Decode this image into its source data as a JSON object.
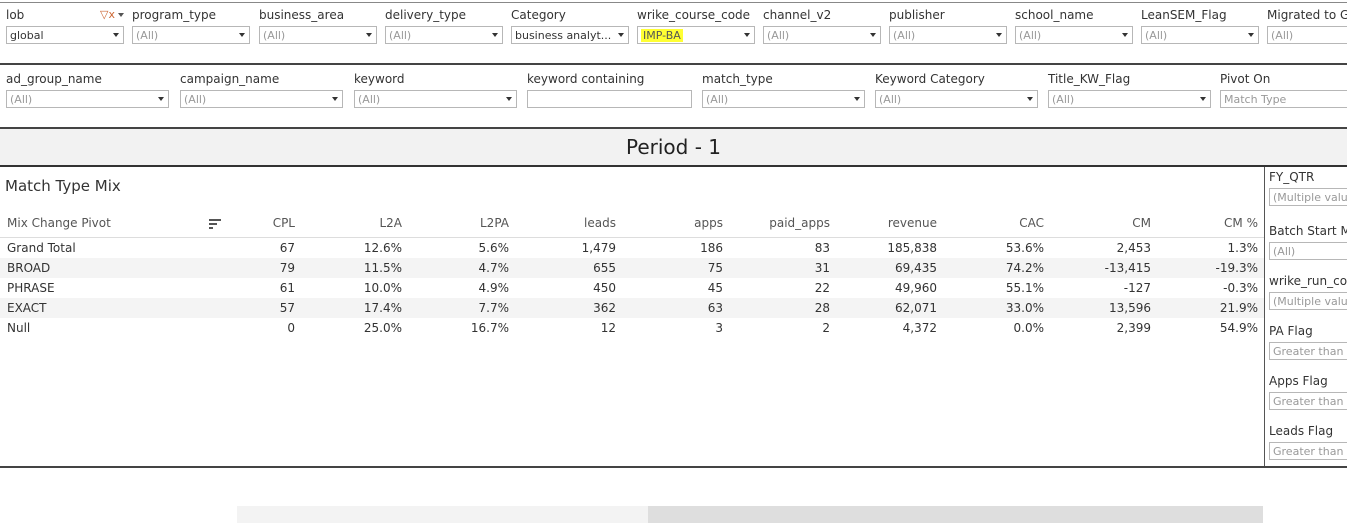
{
  "filters_row1": [
    {
      "label": "lob",
      "value": "global",
      "selected": true,
      "has_filter_icon": true
    },
    {
      "label": "program_type",
      "value": "(All)"
    },
    {
      "label": "business_area",
      "value": "(All)"
    },
    {
      "label": "delivery_type",
      "value": "(All)"
    },
    {
      "label": "Category",
      "value": "business analyt...",
      "selected": true
    },
    {
      "label": "wrike_course_code",
      "value": "IMP-BA",
      "highlighted": true
    },
    {
      "label": "channel_v2",
      "value": "(All)"
    },
    {
      "label": "publisher",
      "value": "(All)"
    },
    {
      "label": "school_name",
      "value": "(All)"
    },
    {
      "label": "LeanSEM_Flag",
      "value": "(All)"
    },
    {
      "label": "Migrated to G",
      "value": "(All)"
    }
  ],
  "filters_row2": [
    {
      "label": "ad_group_name",
      "value": "(All)"
    },
    {
      "label": "campaign_name",
      "value": "(All)"
    },
    {
      "label": "keyword",
      "value": "(All)"
    },
    {
      "label": "keyword containing",
      "value": "",
      "type": "text"
    },
    {
      "label": "match_type",
      "value": "(All)"
    },
    {
      "label": "Keyword Category",
      "value": "(All)"
    },
    {
      "label": "Title_KW_Flag",
      "value": "(All)"
    },
    {
      "label": "Pivot On",
      "value": "Match Type",
      "type": "text"
    }
  ],
  "period_title": "Period - 1",
  "table": {
    "title": "Match Type Mix",
    "columns": [
      "Mix Change Pivot",
      "CPL",
      "L2A",
      "L2PA",
      "leads",
      "apps",
      "paid_apps",
      "revenue",
      "CAC",
      "CM",
      "CM %"
    ],
    "rows": [
      [
        "Grand Total",
        "67",
        "12.6%",
        "5.6%",
        "1,479",
        "186",
        "83",
        "185,838",
        "53.6%",
        "2,453",
        "1.3%"
      ],
      [
        "BROAD",
        "79",
        "11.5%",
        "4.7%",
        "655",
        "75",
        "31",
        "69,435",
        "74.2%",
        "-13,415",
        "-19.3%"
      ],
      [
        "PHRASE",
        "61",
        "10.0%",
        "4.9%",
        "450",
        "45",
        "22",
        "49,960",
        "55.1%",
        "-127",
        "-0.3%"
      ],
      [
        "EXACT",
        "57",
        "17.4%",
        "7.7%",
        "362",
        "63",
        "28",
        "62,071",
        "33.0%",
        "13,596",
        "21.9%"
      ],
      [
        "Null",
        "0",
        "25.0%",
        "16.7%",
        "12",
        "3",
        "2",
        "4,372",
        "0.0%",
        "2,399",
        "54.9%"
      ]
    ]
  },
  "sidebar": [
    {
      "label": "FY_QTR",
      "value": "(Multiple value"
    },
    {
      "label": "Batch Start M",
      "value": "(All)"
    },
    {
      "label": "wrike_run_co",
      "value": "(Multiple valu"
    },
    {
      "label": "PA Flag",
      "value": "Greater than"
    },
    {
      "label": "Apps Flag",
      "value": "Greater than"
    },
    {
      "label": "Leads Flag",
      "value": "Greater than"
    }
  ]
}
